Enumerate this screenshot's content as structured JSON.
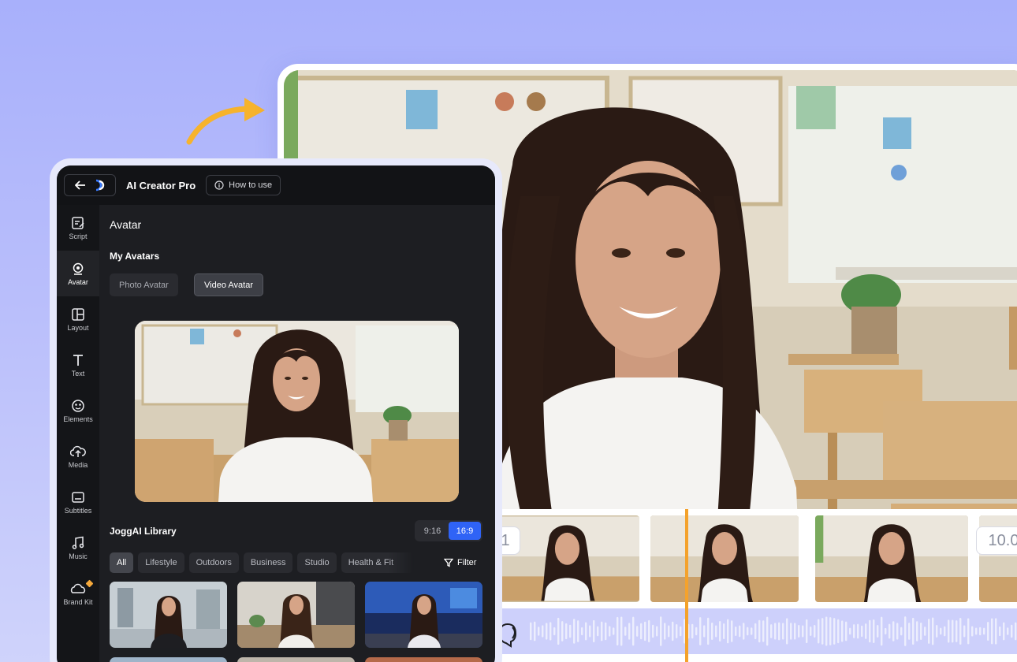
{
  "editor": {
    "app_title": "AI Creator Pro",
    "how_to_label": "How to use"
  },
  "sidebar": {
    "items": [
      {
        "label": "Script",
        "icon": "script-icon"
      },
      {
        "label": "Avatar",
        "icon": "avatar-icon",
        "active": true
      },
      {
        "label": "Layout",
        "icon": "layout-icon"
      },
      {
        "label": "Text",
        "icon": "text-icon"
      },
      {
        "label": "Elements",
        "icon": "elements-icon"
      },
      {
        "label": "Media",
        "icon": "media-icon"
      },
      {
        "label": "Subtitles",
        "icon": "subtitles-icon"
      },
      {
        "label": "Music",
        "icon": "music-icon"
      },
      {
        "label": "Brand Kit",
        "icon": "brand-kit-icon",
        "premium": true
      }
    ]
  },
  "avatar_panel": {
    "title": "Avatar",
    "my_avatars_heading": "My Avatars",
    "tabs": [
      "Photo Avatar",
      "Video Avatar"
    ],
    "selected_tab": "Video Avatar",
    "library_heading": "JoggAI Library",
    "ratios": [
      "9:16",
      "16:9"
    ],
    "selected_ratio": "16:9",
    "categories": [
      "All",
      "Lifestyle",
      "Outdoors",
      "Business",
      "Studio",
      "Health & Fit"
    ],
    "selected_category": "All",
    "filter_label": "Filter"
  },
  "timeline": {
    "clip_badges": [
      "1",
      "10.0"
    ]
  },
  "colors": {
    "background": "#a8b0fb",
    "accent_blue": "#2f63f6",
    "playhead": "#f4a22c",
    "arrow": "#f6b32c",
    "panel_dark": "#1d1e22"
  }
}
